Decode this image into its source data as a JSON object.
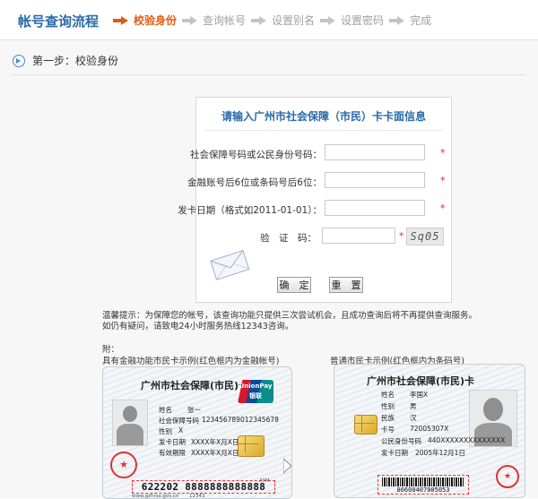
{
  "header": {
    "title": "帐号查询流程",
    "steps": [
      {
        "label": "校验身份",
        "active": true
      },
      {
        "label": "查询帐号",
        "active": false
      },
      {
        "label": "设置别名",
        "active": false
      },
      {
        "label": "设置密码",
        "active": false
      },
      {
        "label": "完成",
        "active": false
      }
    ]
  },
  "stepline": {
    "text": "第一步：校验身份"
  },
  "form": {
    "title": "请输入广州市社会保障（市民）卡卡面信息",
    "fields": [
      {
        "label": "社会保障号码或公民身份号码：",
        "value": "",
        "required": "*"
      },
      {
        "label": "金融账号后6位或条码号后6位：",
        "value": "",
        "required": "*"
      },
      {
        "label": "发卡日期（格式如2011-01-01）：",
        "value": "",
        "required": "*"
      }
    ],
    "captcha": {
      "label": "验　证　码：",
      "value": "",
      "required": "*",
      "code": "Sq05"
    },
    "buttons": {
      "ok": "确　定",
      "reset": "重　置"
    }
  },
  "tips": {
    "line1": "温馨提示：为保障您的帐号，该查询功能只提供三次尝试机会，且成功查询后将不再提供查询服务。",
    "line2": "如仍有疑问，请致电24小时服务热线12343咨询。",
    "appendix": "附：",
    "caption_left": "具有金融功能市民卡示例(红色框内为金融帐号)",
    "caption_right": "普通市民卡示例(红色框内为条码号)"
  },
  "card_left": {
    "title": "广州市社会保障(市民)卡",
    "brand_en": "UnionPay",
    "brand_cn": "银联",
    "fields": [
      {
        "label": "姓名",
        "value": "张一"
      },
      {
        "label": "社会保障号码",
        "value": "123456789012345678"
      },
      {
        "label": "性别",
        "value": "X"
      },
      {
        "label": "发卡日期",
        "value": "XXXX年X月X日"
      },
      {
        "label": "有效期限",
        "value": "XXXX年X月X日"
      }
    ],
    "card_number": "622202 8888888888888",
    "footer_left": "www.gzhrss.gov.cn",
    "footer_mid": "12343",
    "footer_right": "ATM"
  },
  "card_right": {
    "title": "广州市社会保障(市民)卡",
    "fields": [
      {
        "label": "姓名",
        "value": "李国X"
      },
      {
        "label": "性别",
        "value": "男"
      },
      {
        "label": "民族",
        "value": "汉"
      },
      {
        "label": "卡号",
        "value": "72005307X"
      },
      {
        "label": "公民身份号码",
        "value": "440XXXXXXXXXXXXXX"
      },
      {
        "label": "发卡日期",
        "value": "2005年12月1日"
      }
    ],
    "barcode_number": "86600407005053"
  },
  "colors": {
    "brand_blue": "#2a6aa8",
    "active_step": "#e05b10",
    "required": "#ee2222"
  }
}
